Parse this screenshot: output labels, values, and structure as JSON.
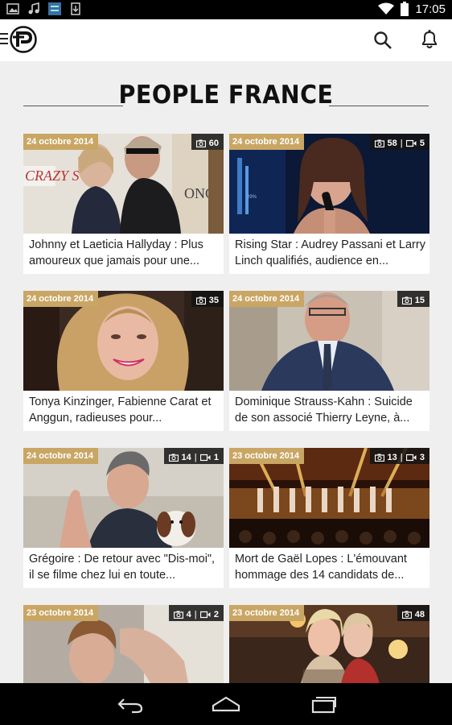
{
  "status_bar": {
    "time": "17:05",
    "icons": [
      "image-icon",
      "music-icon",
      "app-icon",
      "download-icon",
      "wifi-icon",
      "battery-icon"
    ]
  },
  "app_bar": {
    "icons": [
      "menu-icon",
      "logo-icon",
      "search-icon",
      "bell-icon"
    ]
  },
  "section": {
    "title": "PEOPLE FRANCE"
  },
  "colors": {
    "date_badge": "#c9a664",
    "background": "#efefef"
  },
  "articles": [
    {
      "date": "24 octobre 2014",
      "photos": "60",
      "videos": "",
      "title": "Johnny et Laeticia Hallyday : Plus amoureux que jamais pour une..."
    },
    {
      "date": "24 octobre 2014",
      "photos": "58",
      "videos": "5",
      "title": "Rising Star : Audrey Passani et Larry Linch qualifiés, audience en..."
    },
    {
      "date": "24 octobre 2014",
      "photos": "35",
      "videos": "",
      "title": "Tonya Kinzinger, Fabienne Carat et Anggun, radieuses pour..."
    },
    {
      "date": "24 octobre 2014",
      "photos": "15",
      "videos": "",
      "title": "Dominique Strauss-Kahn : Suicide de son associé Thierry Leyne, à..."
    },
    {
      "date": "24 octobre 2014",
      "photos": "14",
      "videos": "1",
      "title": "Grégoire : De retour avec \"Dis-moi\", il se filme chez lui en toute..."
    },
    {
      "date": "23 octobre 2014",
      "photos": "13",
      "videos": "3",
      "title": "Mort de Gaël Lopes : L'émouvant hommage des 14 candidats de..."
    },
    {
      "date": "23 octobre 2014",
      "photos": "4",
      "videos": "2",
      "title": ""
    },
    {
      "date": "23 octobre 2014",
      "photos": "48",
      "videos": "",
      "title": ""
    }
  ],
  "nav_bar": {
    "icons": [
      "back-icon",
      "home-icon",
      "recents-icon"
    ]
  }
}
